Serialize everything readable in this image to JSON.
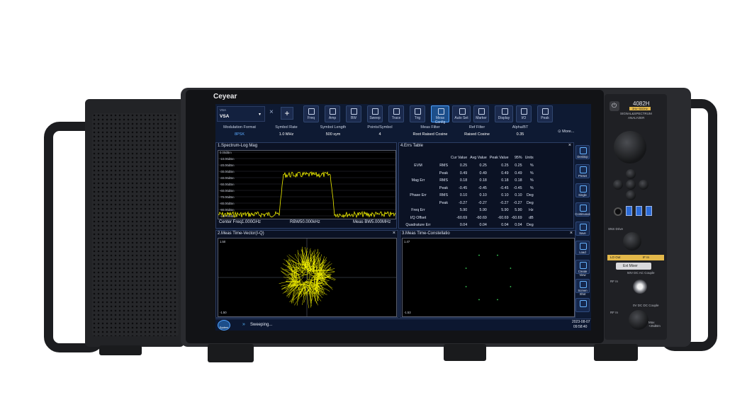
{
  "device": {
    "brand": "Ceyear",
    "model": "4082H",
    "model_tag": "3Hz~50GHz",
    "model_desc_1": "SIGNAL&SPECTRUM",
    "model_desc_2": "ANALYZER",
    "labels": {
      "sns_drive": "SNS Drive",
      "lo_out": "LO Out",
      "if_in": "IF In",
      "ext_mixer": "Ext Mixer",
      "dc_couple": "50V DC AC Couple",
      "rf_in": "RF In",
      "rf_in_2": "RF In",
      "dc_couple_2": "0V DC DC Couple",
      "max": "Max +25dBm"
    }
  },
  "toolbar": {
    "mode_label": "VSA",
    "mode_value": "VSA",
    "close_glyph": "×",
    "add_glyph": "+",
    "buttons": [
      "Freq",
      "Amp",
      "BW",
      "Sweep",
      "Trace",
      "Trig",
      "Meas Config",
      "Auto Set",
      "Marker",
      "Display",
      "I/O",
      "Peak"
    ],
    "active": "Meas Config"
  },
  "params": [
    {
      "label": "Modulation Format",
      "value": "8PSK"
    },
    {
      "label": "Symbol Rate",
      "value": "1.0 MHz"
    },
    {
      "label": "Symbol Length",
      "value": "500 sym"
    },
    {
      "label": "Points/Symbol",
      "value": "4"
    },
    {
      "label": "Meas Filter",
      "value": "Root Raised Cosine"
    },
    {
      "label": "Ref Filter",
      "value": "Raised Cosine"
    },
    {
      "label": "Alpha/BT",
      "value": "0.35"
    }
  ],
  "more_label": "More...",
  "spectrum": {
    "title": "1.Spectrum-Log Mag",
    "ylabels": [
      "0.00dBm",
      "-10.00dBm",
      "-20.00dBm",
      "-30.00dBm",
      "-40.00dBm",
      "-50.00dBm",
      "-60.00dBm",
      "-70.00dBm",
      "-80.00dBm",
      "-90.00dBm",
      "-100.00dBm"
    ],
    "center": "Center Freq1.000GHz",
    "rbw": "RBW50.000kHz",
    "meas_bw": "Meas BW5.000MHz"
  },
  "errs": {
    "title": "4.Errs Table",
    "headers": [
      "Cur Value",
      "Avg Value",
      "Peak Value",
      "95%",
      "Units"
    ],
    "rows": [
      {
        "group": "EVM",
        "sub": "RMS",
        "cur": "0.25",
        "avg": "0.25",
        "peak": "0.25",
        "p95": "0.25",
        "unit": "%"
      },
      {
        "group": "",
        "sub": "Peak",
        "cur": "0.49",
        "avg": "0.49",
        "peak": "0.49",
        "p95": "0.49",
        "unit": "%"
      },
      {
        "group": "Mag Err",
        "sub": "RMS",
        "cur": "0.18",
        "avg": "0.18",
        "peak": "0.18",
        "p95": "0.18",
        "unit": "%"
      },
      {
        "group": "",
        "sub": "Peak",
        "cur": "-0.45",
        "avg": "-0.45",
        "peak": "-0.45",
        "p95": "-0.45",
        "unit": "%"
      },
      {
        "group": "Phase Err",
        "sub": "RMS",
        "cur": "0.10",
        "avg": "0.10",
        "peak": "0.10",
        "p95": "0.10",
        "unit": "Deg"
      },
      {
        "group": "",
        "sub": "Peak",
        "cur": "-0.27",
        "avg": "-0.27",
        "peak": "-0.27",
        "p95": "-0.27",
        "unit": "Deg"
      },
      {
        "group": "Freq Err",
        "sub": "",
        "cur": "5.90",
        "avg": "5.90",
        "peak": "5.90",
        "p95": "5.90",
        "unit": "Hz"
      },
      {
        "group": "I/Q Offset",
        "sub": "",
        "cur": "-60.69",
        "avg": "-60.69",
        "peak": "-60.69",
        "p95": "-60.69",
        "unit": "dB"
      },
      {
        "group": "Quadrature Err",
        "sub": "",
        "cur": "0.04",
        "avg": "0.04",
        "peak": "0.04",
        "p95": "0.04",
        "unit": "Deg"
      }
    ]
  },
  "iq": {
    "title": "2.Meas Time-Vector(I-Q)",
    "ytop": "1.50",
    "ybot": "-1.50"
  },
  "constellation": {
    "title": "3.Meas Time-Constellatio",
    "ytop": "1.47",
    "ybot": "-1.53"
  },
  "sidebar": [
    "Desktop",
    "Preset",
    "Single",
    "Continuous",
    "Save",
    "Load",
    "Create View",
    "Screen Shot",
    ""
  ],
  "status": {
    "system_label": "System",
    "sweep_text": "Sweeping...",
    "date": "2023-08-07",
    "time": "09:58:40"
  }
}
